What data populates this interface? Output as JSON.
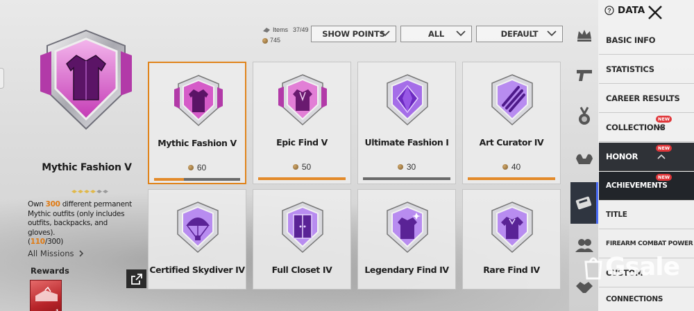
{
  "detail": {
    "title": "Mythic Fashion V",
    "desc_prefix": "Own ",
    "desc_count": "300",
    "desc_body": " different permanent Mythic outfits (only includes outfits, backpacks, and gloves).",
    "progress_open": "(",
    "progress_current": "110",
    "progress_total": "/300)",
    "all_missions_label": "All Missions",
    "rewards_label": "Rewards",
    "reward_count": "1",
    "star_level": 4,
    "star_max": 6
  },
  "top_bar": {
    "items_label": "Items",
    "items_value": "37/49",
    "points_value": "745",
    "dropdowns": [
      "SHOW POINTS",
      "ALL",
      "DEFAULT"
    ]
  },
  "achievements": [
    {
      "name": "Mythic Fashion V",
      "points": "60",
      "progress": 0.35,
      "selected": true,
      "icon": "mythic-jacket-icon"
    },
    {
      "name": "Epic Find V",
      "points": "50",
      "progress": 1.0,
      "icon": "epic-jacket-icon"
    },
    {
      "name": "Ultimate Fashion I",
      "points": "30",
      "progress": 0.0,
      "icon": "diamond-icon"
    },
    {
      "name": "Art Curator IV",
      "points": "40",
      "progress": 1.0,
      "icon": "claw-marks-icon"
    },
    {
      "name": "Certified Skydiver IV",
      "icon": "parachute-icon"
    },
    {
      "name": "Full Closet IV",
      "icon": "wardrobe-icon"
    },
    {
      "name": "Legendary Find IV",
      "icon": "sparkle-jacket-icon"
    },
    {
      "name": "Rare Find IV",
      "icon": "shirt-icon"
    }
  ],
  "menu": {
    "header": "DATA",
    "items": {
      "basic_info": "BASIC INFO",
      "statistics": "STATISTICS",
      "career_results": "CAREER RESULTS",
      "collections": "COLLECTIONS",
      "honor": "HONOR",
      "achievements": "ACHIEVEMENTS",
      "title": "TITLE",
      "firearm": "FIREARM COMBAT POWER",
      "custom": "CUSTOM",
      "connections": "CONNECTIONS"
    },
    "new_tag": "NEW"
  },
  "watermark": "Gsale",
  "colors": {
    "accent": "#e07a12",
    "badge_pink": "#c43bb5",
    "badge_purple": "#8a4fd6",
    "active_blue": "#4a6cf7"
  }
}
